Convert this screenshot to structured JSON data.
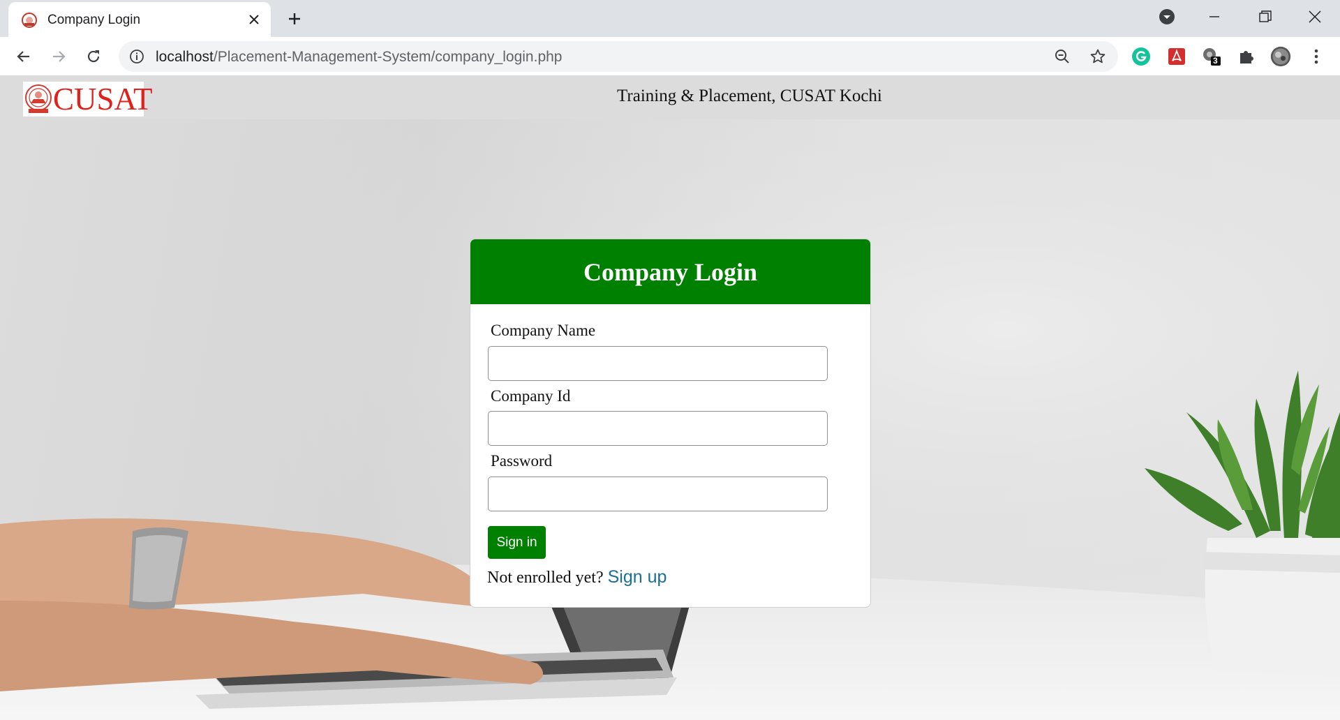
{
  "browser": {
    "tab_title": "Company Login",
    "url_host": "localhost",
    "url_path": "/Placement-Management-System/company_login.php",
    "extension_badge": "3"
  },
  "site": {
    "logo_text": "CUSAT",
    "header_title": "Training & Placement, CUSAT Kochi"
  },
  "login": {
    "title": "Company Login",
    "fields": [
      {
        "label": "Company Name",
        "value": "",
        "type": "text"
      },
      {
        "label": "Company Id",
        "value": "",
        "type": "text"
      },
      {
        "label": "Password",
        "value": "",
        "type": "password"
      }
    ],
    "submit_label": "Sign in",
    "signup_prompt": "Not enrolled yet?",
    "signup_link": "Sign up"
  },
  "colors": {
    "primary_green": "#008000",
    "link_blue": "#1a6f93",
    "logo_red": "#e0201b"
  }
}
